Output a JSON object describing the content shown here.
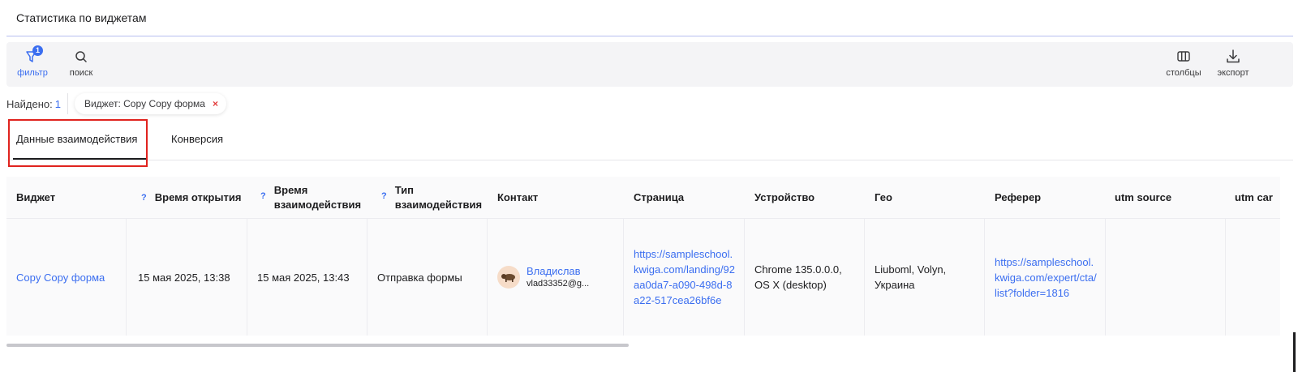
{
  "header": {
    "title": "Статистика по виджетам"
  },
  "toolbar": {
    "filter_label": "фильтр",
    "filter_badge": "1",
    "search_label": "поиск",
    "columns_label": "столбцы",
    "export_label": "экспорт"
  },
  "found": {
    "label": "Найдено:",
    "count": "1"
  },
  "filter_chip": {
    "label": "Виджет: Copy Copy форма",
    "remove": "×"
  },
  "tabs": [
    {
      "label": "Данные взаимодействия",
      "active": true
    },
    {
      "label": "Конверсия",
      "active": false
    }
  ],
  "table": {
    "help_mark": "?",
    "headers": {
      "widget": "Виджет",
      "open_time": "Время открытия",
      "interaction_time_1": "Время",
      "interaction_time_2": "взаимодействия",
      "interaction_type_1": "Тип",
      "interaction_type_2": "взаимодействия",
      "contact": "Контакт",
      "page": "Страница",
      "device": "Устройство",
      "geo": "Гео",
      "referer": "Реферер",
      "utm_source": "utm source",
      "utm_campaign": "utm car"
    },
    "rows": [
      {
        "widget": "Copy Copy форма",
        "open_time": "15 мая 2025, 13:38",
        "interaction_time": "15 мая 2025, 13:43",
        "interaction_type": "Отправка формы",
        "contact_name": "Владислав",
        "contact_email": "vlad33352@g...",
        "page": "https://sampleschool.kwiga.com/landing/92aa0da7-a090-498d-8a22-517cea26bf6e",
        "device": "Chrome 135.0.0.0, OS X (desktop)",
        "geo": "Liuboml, Volyn, Украина",
        "referer": "https://sampleschool.kwiga.com/expert/cta/list?folder=1816",
        "utm_source": "",
        "utm_campaign": ""
      }
    ]
  }
}
